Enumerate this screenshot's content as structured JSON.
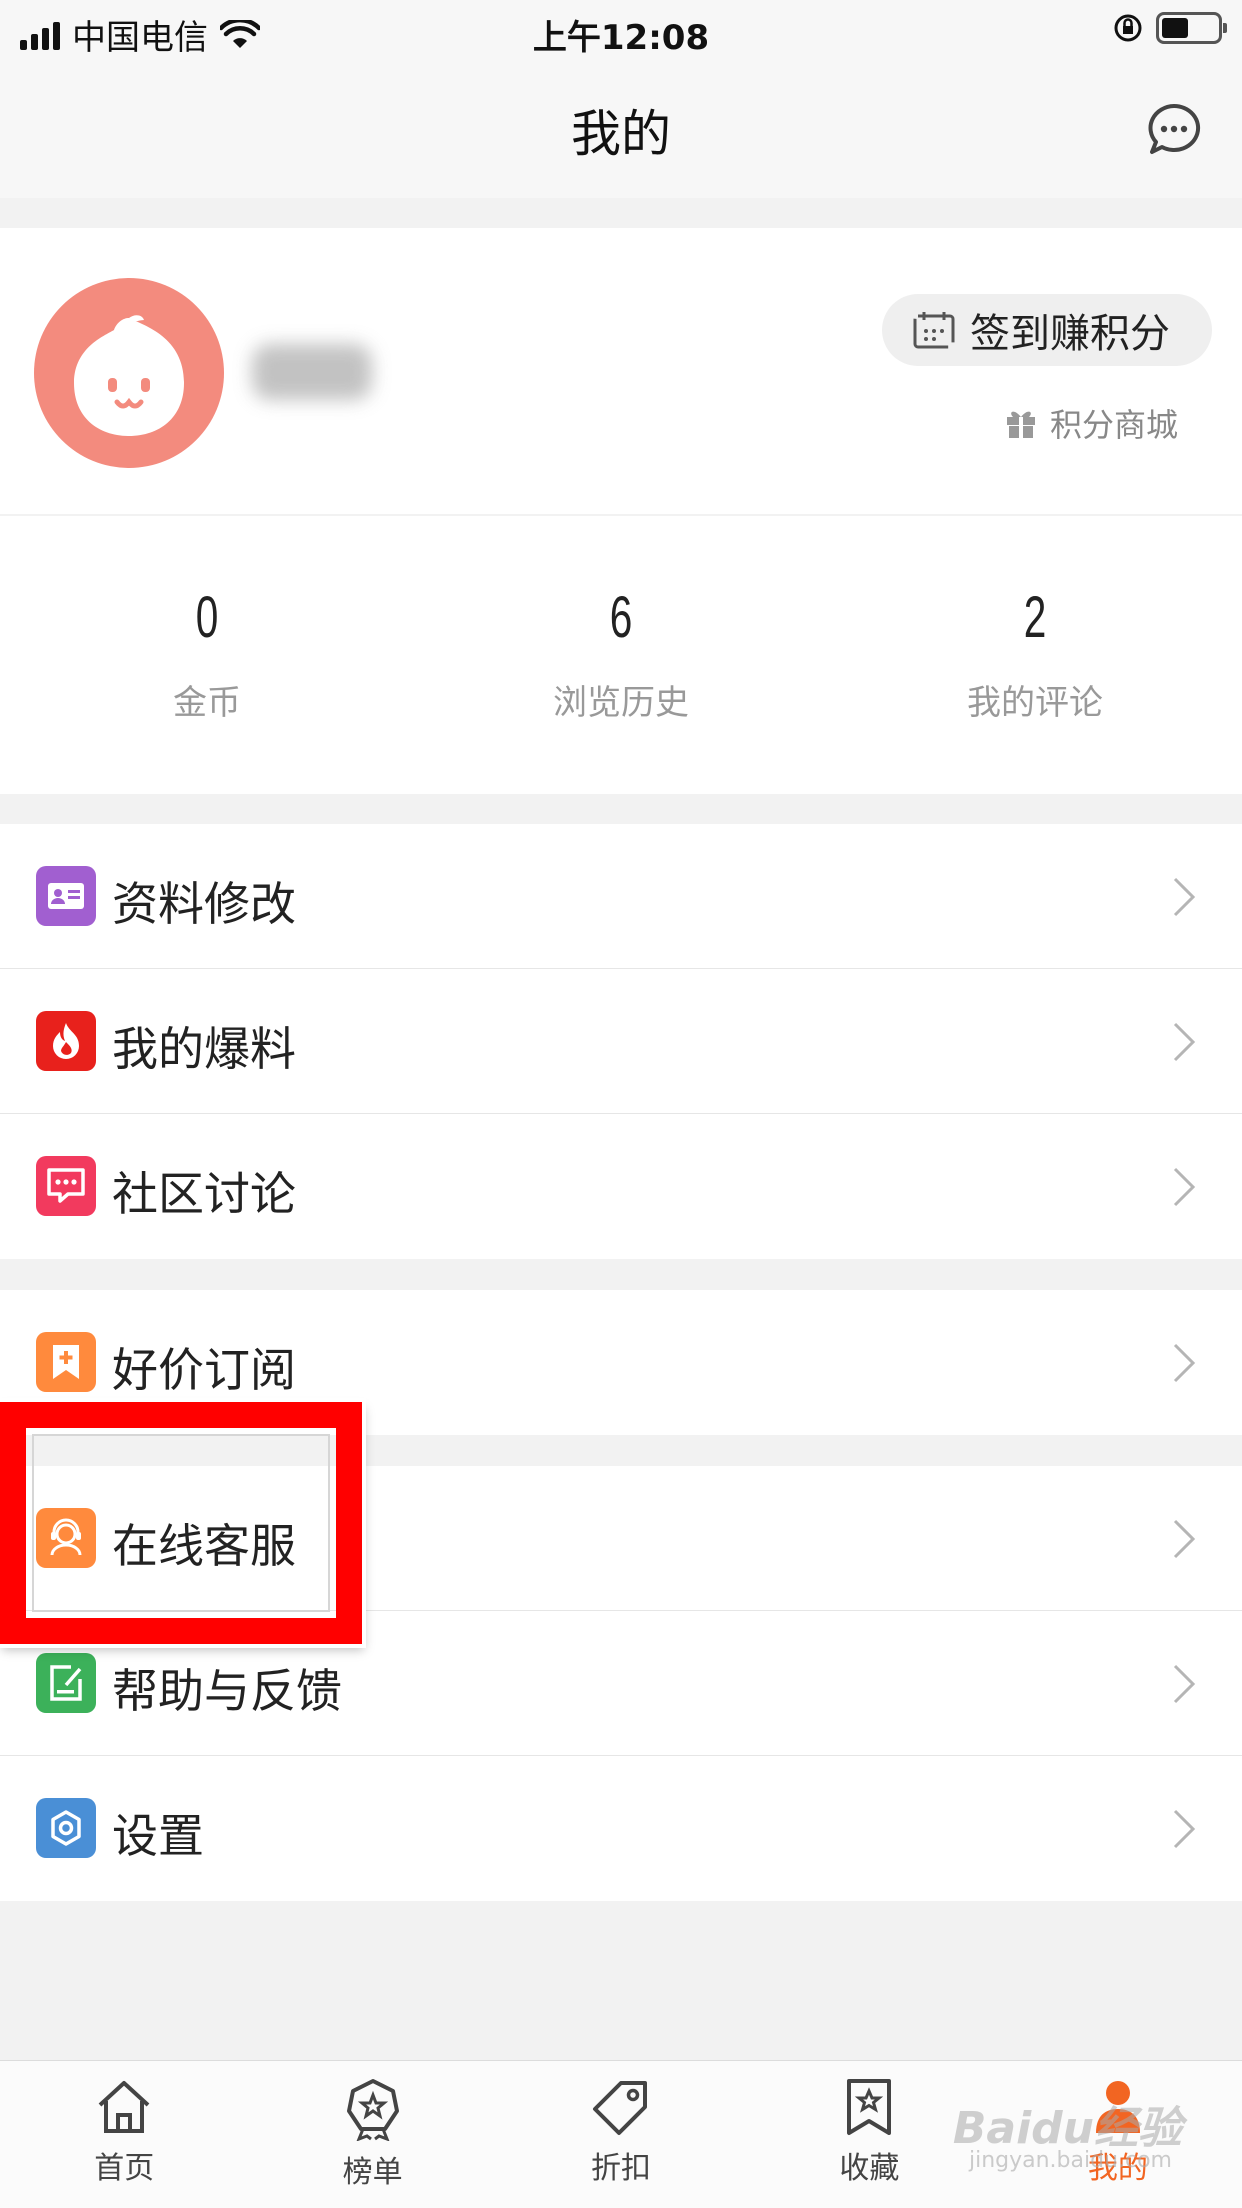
{
  "status_bar": {
    "carrier": "中国电信",
    "time": "上午12:08"
  },
  "nav": {
    "title": "我的"
  },
  "profile": {
    "checkin_label": "签到赚积分",
    "points_mall_label": "积分商城"
  },
  "stats": [
    {
      "value": "0",
      "label": "金币"
    },
    {
      "value": "6",
      "label": "浏览历史"
    },
    {
      "value": "2",
      "label": "我的评论"
    }
  ],
  "menu": {
    "group1": [
      {
        "label": "资料修改",
        "icon": "profile-card-icon",
        "color": "#a15fd0"
      },
      {
        "label": "我的爆料",
        "icon": "flame-icon",
        "color": "#e8211c"
      },
      {
        "label": "社区讨论",
        "icon": "chat-bubble-icon",
        "color": "#f23a5e"
      }
    ],
    "group2": [
      {
        "label": "好价订阅",
        "icon": "bookmark-plus-icon",
        "color": "#ff8a3d"
      }
    ],
    "group3": [
      {
        "label": "在线客服",
        "icon": "customer-service-icon",
        "color": "#ff8a3d"
      },
      {
        "label": "帮助与反馈",
        "icon": "feedback-icon",
        "color": "#3cb15a"
      },
      {
        "label": "设置",
        "icon": "settings-icon",
        "color": "#4a8fd6"
      }
    ]
  },
  "tabs": [
    {
      "label": "首页",
      "icon": "home-icon"
    },
    {
      "label": "榜单",
      "icon": "ranking-icon"
    },
    {
      "label": "折扣",
      "icon": "tag-icon"
    },
    {
      "label": "收藏",
      "icon": "favorite-icon"
    },
    {
      "label": "我的",
      "icon": "profile-icon",
      "active": true
    }
  ],
  "colors": {
    "accent": "#f26522",
    "highlight": "#ff0000",
    "avatar_bg": "#f38b7e"
  },
  "watermark": {
    "brand": "Baidu经验",
    "url": "jingyan.baidu.com"
  }
}
